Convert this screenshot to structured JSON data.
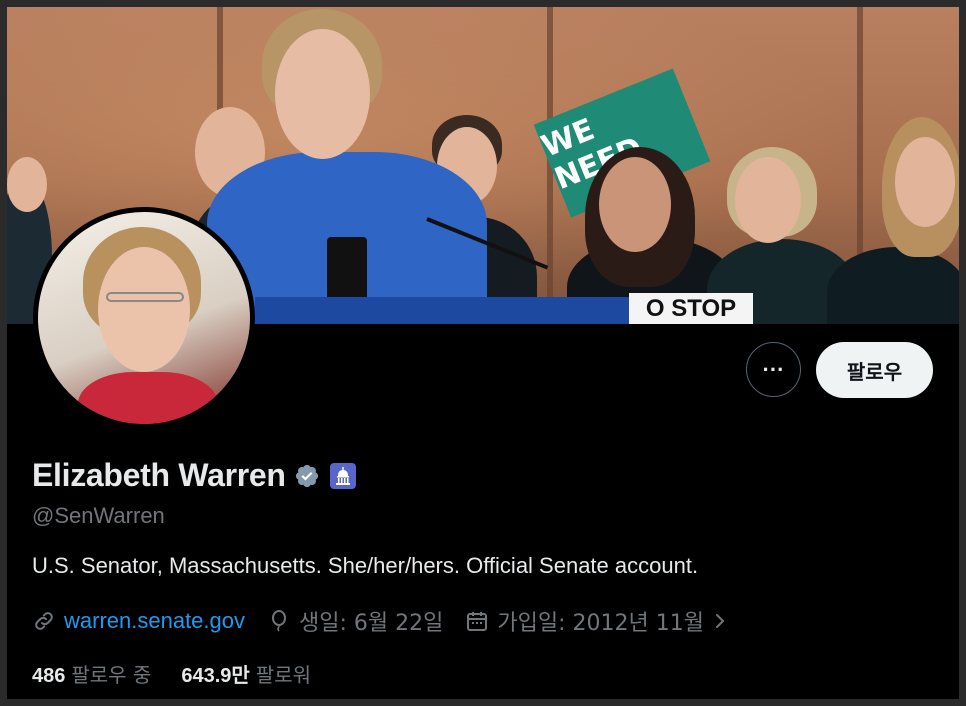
{
  "profile": {
    "name": "Elizabeth Warren",
    "handle": "@SenWarren",
    "bio": "U.S. Senator, Massachusetts. She/her/hers. Official Senate account.",
    "website": "warren.senate.gov",
    "birthday": "생일: 6월 22일",
    "joined": "가입일: 2012년 11월",
    "following_count": "486",
    "following_label": "팔로우 중",
    "followers_count": "643.9만",
    "followers_label": "팔로워"
  },
  "actions": {
    "more_label": "···",
    "follow_label": "팔로우"
  },
  "banner": {
    "sign_text": "WE NEED",
    "stop_text": "O STOP"
  },
  "colors": {
    "background": "#000000",
    "accent_link": "#1d9bf0",
    "text_primary": "#e7e9ea",
    "text_secondary": "#71767b",
    "follow_button_bg": "#eff3f4",
    "verified_badge": "#829aab",
    "gov_badge": "#5865c9"
  },
  "icons": {
    "verified": "verified-badge-icon",
    "gov": "capitol-icon",
    "link": "link-icon",
    "birthday": "balloon-icon",
    "joined": "calendar-icon",
    "chevron": "chevron-right-icon"
  }
}
